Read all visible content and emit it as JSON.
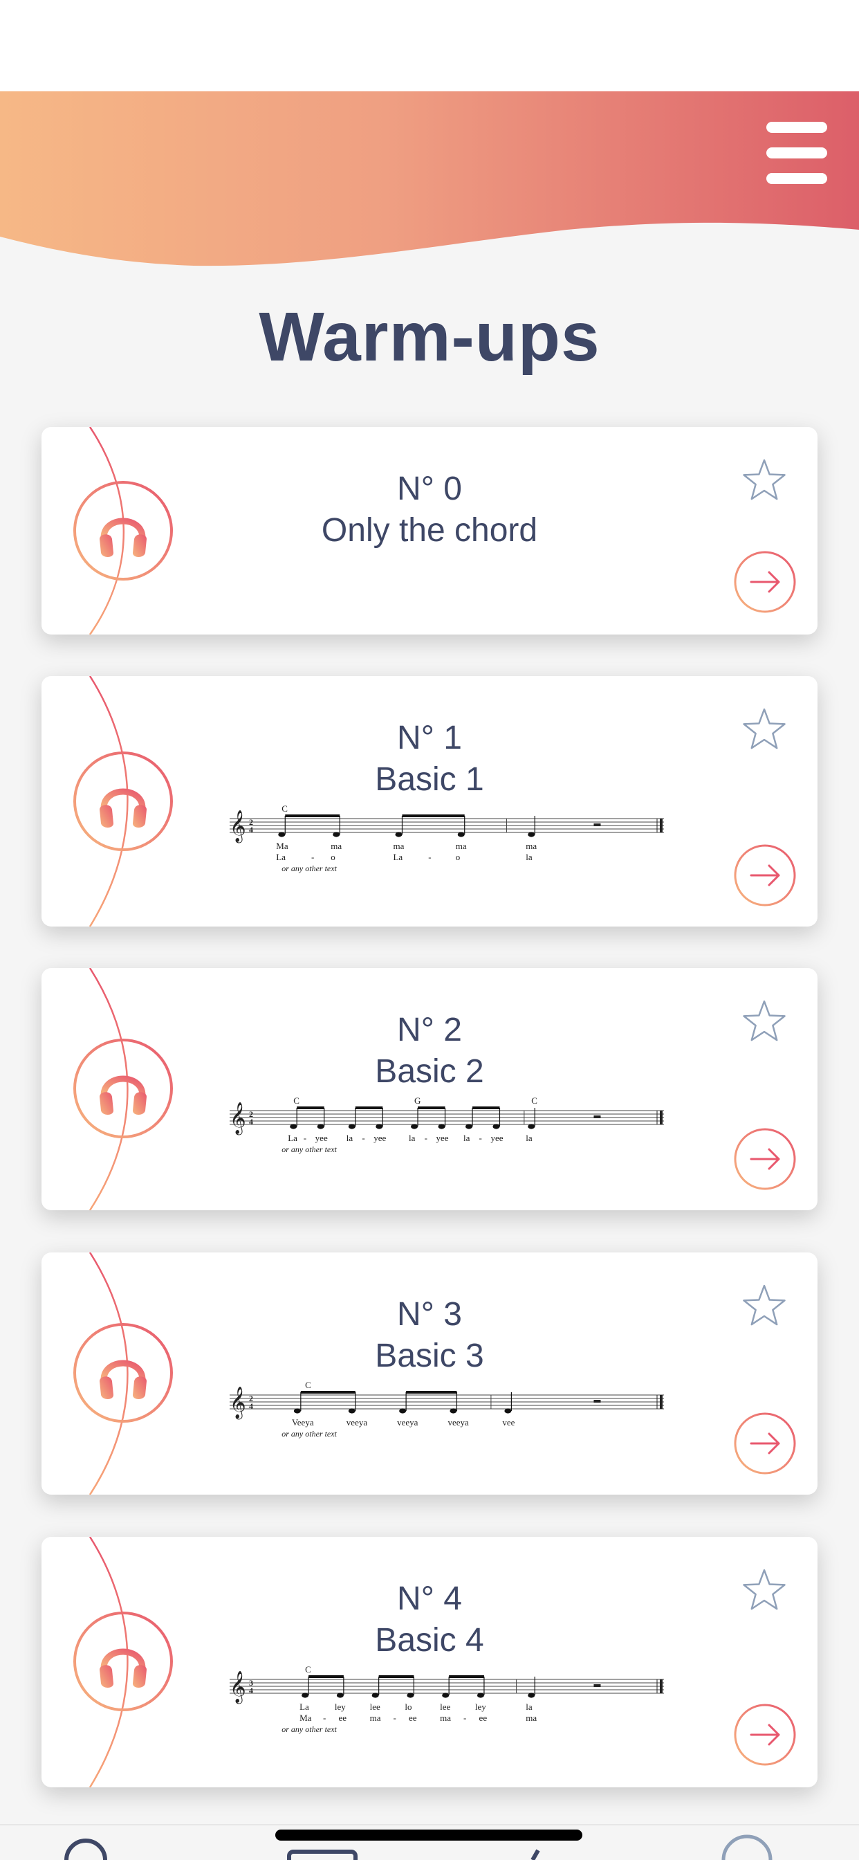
{
  "page": {
    "title": "Warm-ups"
  },
  "colors": {
    "accent_start": "#f7b57e",
    "accent_end": "#e8586e",
    "title": "#3e4766",
    "star": "#8fa0b8"
  },
  "icons": {
    "menu": "hamburger-icon",
    "listen": "headphones-icon",
    "favorite": "star-outline-icon",
    "open": "arrow-right-circle-icon"
  },
  "warmups": [
    {
      "number": "N° 0",
      "name": "Only the chord",
      "score": null
    },
    {
      "number": "N° 1",
      "name": "Basic 1",
      "score": {
        "time": [
          "2",
          "4"
        ],
        "chords": [
          {
            "label": "C",
            "pos": 0.02
          }
        ],
        "lyrics1": [
          {
            "t": "Ma",
            "p": 0.02
          },
          {
            "t": "ma",
            "p": 0.16
          },
          {
            "t": "ma",
            "p": 0.32
          },
          {
            "t": "ma",
            "p": 0.48
          },
          {
            "t": "ma",
            "p": 0.66
          }
        ],
        "lyrics2": [
          {
            "t": "La",
            "p": 0.02
          },
          {
            "t": "-",
            "p": 0.11
          },
          {
            "t": "o",
            "p": 0.16
          },
          {
            "t": "La",
            "p": 0.32
          },
          {
            "t": "-",
            "p": 0.41
          },
          {
            "t": "o",
            "p": 0.48
          },
          {
            "t": "la",
            "p": 0.66
          }
        ],
        "note": "or any other text"
      }
    },
    {
      "number": "N° 2",
      "name": "Basic 2",
      "score": {
        "time": [
          "2",
          "4"
        ],
        "chords": [
          {
            "label": "C",
            "pos": 0.05
          },
          {
            "label": "G",
            "pos": 0.36
          },
          {
            "label": "C",
            "pos": 0.66
          }
        ],
        "lyrics1": [
          {
            "t": "La",
            "p": 0.05
          },
          {
            "t": "-",
            "p": 0.09
          },
          {
            "t": "yee",
            "p": 0.12
          },
          {
            "t": "la",
            "p": 0.2
          },
          {
            "t": "-",
            "p": 0.24
          },
          {
            "t": "yee",
            "p": 0.27
          },
          {
            "t": "la",
            "p": 0.36
          },
          {
            "t": "-",
            "p": 0.4
          },
          {
            "t": "yee",
            "p": 0.43
          },
          {
            "t": "la",
            "p": 0.5
          },
          {
            "t": "-",
            "p": 0.54
          },
          {
            "t": "yee",
            "p": 0.57
          },
          {
            "t": "la",
            "p": 0.66
          }
        ],
        "lyrics2": [],
        "note": "or any other text"
      }
    },
    {
      "number": "N° 3",
      "name": "Basic 3",
      "score": {
        "time": [
          "2",
          "4"
        ],
        "chords": [
          {
            "label": "C",
            "pos": 0.08
          }
        ],
        "lyrics1": [
          {
            "t": "Veeya",
            "p": 0.06
          },
          {
            "t": "veeya",
            "p": 0.2
          },
          {
            "t": "veeya",
            "p": 0.33
          },
          {
            "t": "veeya",
            "p": 0.46
          },
          {
            "t": "vee",
            "p": 0.6
          }
        ],
        "lyrics2": [],
        "note": "or any other text"
      }
    },
    {
      "number": "N° 4",
      "name": "Basic 4",
      "score": {
        "time": [
          "3",
          "4"
        ],
        "chords": [
          {
            "label": "C",
            "pos": 0.08
          }
        ],
        "lyrics1": [
          {
            "t": "La",
            "p": 0.08
          },
          {
            "t": "ley",
            "p": 0.17
          },
          {
            "t": "lee",
            "p": 0.26
          },
          {
            "t": "lo",
            "p": 0.35
          },
          {
            "t": "lee",
            "p": 0.44
          },
          {
            "t": "ley",
            "p": 0.53
          },
          {
            "t": "la",
            "p": 0.66
          }
        ],
        "lyrics2": [
          {
            "t": "Ma",
            "p": 0.08
          },
          {
            "t": "-",
            "p": 0.14
          },
          {
            "t": "ee",
            "p": 0.18
          },
          {
            "t": "ma",
            "p": 0.26
          },
          {
            "t": "-",
            "p": 0.32
          },
          {
            "t": "ee",
            "p": 0.36
          },
          {
            "t": "ma",
            "p": 0.44
          },
          {
            "t": "-",
            "p": 0.5
          },
          {
            "t": "ee",
            "p": 0.54
          },
          {
            "t": "ma",
            "p": 0.66
          }
        ],
        "note": "or any other text"
      }
    }
  ]
}
